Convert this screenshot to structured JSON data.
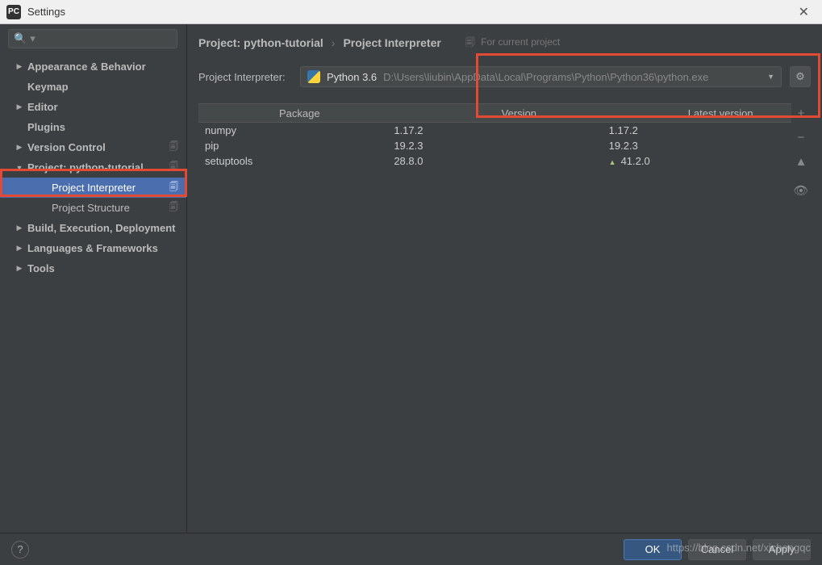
{
  "titlebar": {
    "app_badge": "PC",
    "title": "Settings",
    "close": "✕"
  },
  "search": {
    "placeholder": "",
    "icon": "🔍",
    "dd": "▾"
  },
  "tree": [
    {
      "label": "Appearance & Behavior",
      "arrow": "▶",
      "copy": false,
      "child": false
    },
    {
      "label": "Keymap",
      "arrow": "",
      "copy": false,
      "child": false
    },
    {
      "label": "Editor",
      "arrow": "▶",
      "copy": false,
      "child": false
    },
    {
      "label": "Plugins",
      "arrow": "",
      "copy": false,
      "child": false
    },
    {
      "label": "Version Control",
      "arrow": "▶",
      "copy": true,
      "child": false
    },
    {
      "label": "Project: python-tutorial",
      "arrow": "▼",
      "copy": true,
      "child": false
    },
    {
      "label": "Project Interpreter",
      "arrow": "",
      "copy": true,
      "child": true,
      "selected": true
    },
    {
      "label": "Project Structure",
      "arrow": "",
      "copy": true,
      "child": true
    },
    {
      "label": "Build, Execution, Deployment",
      "arrow": "▶",
      "copy": false,
      "child": false
    },
    {
      "label": "Languages & Frameworks",
      "arrow": "▶",
      "copy": false,
      "child": false
    },
    {
      "label": "Tools",
      "arrow": "▶",
      "copy": false,
      "child": false
    }
  ],
  "breadcrumb": {
    "part1": "Project: python-tutorial",
    "sep": "›",
    "part2": "Project Interpreter",
    "note_icon": "🗐",
    "note": "For current project"
  },
  "interpreter": {
    "label": "Project Interpreter:",
    "name": "Python 3.6",
    "path": "D:\\Users\\liubin\\AppData\\Local\\Programs\\Python\\Python36\\python.exe",
    "gear": "⚙"
  },
  "table": {
    "headers": [
      "Package",
      "Version",
      "Latest version"
    ],
    "rows": [
      {
        "pkg": "numpy",
        "ver": "1.17.2",
        "latest": "1.17.2",
        "upgrade": false
      },
      {
        "pkg": "pip",
        "ver": "19.2.3",
        "latest": "19.2.3",
        "upgrade": false
      },
      {
        "pkg": "setuptools",
        "ver": "28.8.0",
        "latest": "41.2.0",
        "upgrade": true
      }
    ]
  },
  "sidetools": {
    "add": "+",
    "remove": "−",
    "up": "▲",
    "eye": "👁"
  },
  "footer": {
    "help": "?",
    "ok": "OK",
    "cancel": "Cancel",
    "apply": "Apply"
  },
  "watermark": "https://blog.csdn.net/xichengqc"
}
